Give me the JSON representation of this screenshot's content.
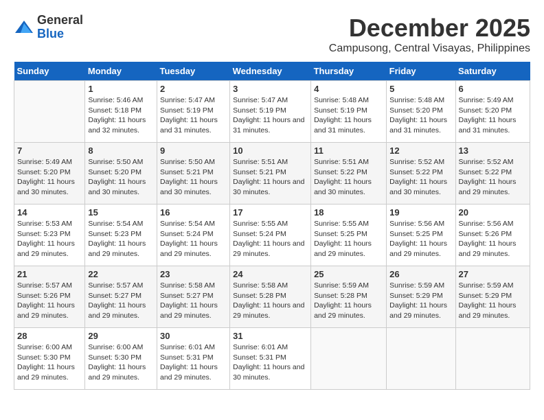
{
  "logo": {
    "text_general": "General",
    "text_blue": "Blue"
  },
  "title": "December 2025",
  "subtitle": "Campusong, Central Visayas, Philippines",
  "weekdays": [
    "Sunday",
    "Monday",
    "Tuesday",
    "Wednesday",
    "Thursday",
    "Friday",
    "Saturday"
  ],
  "weeks": [
    [
      {
        "day": "",
        "sunrise": "",
        "sunset": "",
        "daylight": ""
      },
      {
        "day": "1",
        "sunrise": "Sunrise: 5:46 AM",
        "sunset": "Sunset: 5:18 PM",
        "daylight": "Daylight: 11 hours and 32 minutes."
      },
      {
        "day": "2",
        "sunrise": "Sunrise: 5:47 AM",
        "sunset": "Sunset: 5:19 PM",
        "daylight": "Daylight: 11 hours and 31 minutes."
      },
      {
        "day": "3",
        "sunrise": "Sunrise: 5:47 AM",
        "sunset": "Sunset: 5:19 PM",
        "daylight": "Daylight: 11 hours and 31 minutes."
      },
      {
        "day": "4",
        "sunrise": "Sunrise: 5:48 AM",
        "sunset": "Sunset: 5:19 PM",
        "daylight": "Daylight: 11 hours and 31 minutes."
      },
      {
        "day": "5",
        "sunrise": "Sunrise: 5:48 AM",
        "sunset": "Sunset: 5:20 PM",
        "daylight": "Daylight: 11 hours and 31 minutes."
      },
      {
        "day": "6",
        "sunrise": "Sunrise: 5:49 AM",
        "sunset": "Sunset: 5:20 PM",
        "daylight": "Daylight: 11 hours and 31 minutes."
      }
    ],
    [
      {
        "day": "7",
        "sunrise": "Sunrise: 5:49 AM",
        "sunset": "Sunset: 5:20 PM",
        "daylight": "Daylight: 11 hours and 30 minutes."
      },
      {
        "day": "8",
        "sunrise": "Sunrise: 5:50 AM",
        "sunset": "Sunset: 5:20 PM",
        "daylight": "Daylight: 11 hours and 30 minutes."
      },
      {
        "day": "9",
        "sunrise": "Sunrise: 5:50 AM",
        "sunset": "Sunset: 5:21 PM",
        "daylight": "Daylight: 11 hours and 30 minutes."
      },
      {
        "day": "10",
        "sunrise": "Sunrise: 5:51 AM",
        "sunset": "Sunset: 5:21 PM",
        "daylight": "Daylight: 11 hours and 30 minutes."
      },
      {
        "day": "11",
        "sunrise": "Sunrise: 5:51 AM",
        "sunset": "Sunset: 5:22 PM",
        "daylight": "Daylight: 11 hours and 30 minutes."
      },
      {
        "day": "12",
        "sunrise": "Sunrise: 5:52 AM",
        "sunset": "Sunset: 5:22 PM",
        "daylight": "Daylight: 11 hours and 30 minutes."
      },
      {
        "day": "13",
        "sunrise": "Sunrise: 5:52 AM",
        "sunset": "Sunset: 5:22 PM",
        "daylight": "Daylight: 11 hours and 29 minutes."
      }
    ],
    [
      {
        "day": "14",
        "sunrise": "Sunrise: 5:53 AM",
        "sunset": "Sunset: 5:23 PM",
        "daylight": "Daylight: 11 hours and 29 minutes."
      },
      {
        "day": "15",
        "sunrise": "Sunrise: 5:54 AM",
        "sunset": "Sunset: 5:23 PM",
        "daylight": "Daylight: 11 hours and 29 minutes."
      },
      {
        "day": "16",
        "sunrise": "Sunrise: 5:54 AM",
        "sunset": "Sunset: 5:24 PM",
        "daylight": "Daylight: 11 hours and 29 minutes."
      },
      {
        "day": "17",
        "sunrise": "Sunrise: 5:55 AM",
        "sunset": "Sunset: 5:24 PM",
        "daylight": "Daylight: 11 hours and 29 minutes."
      },
      {
        "day": "18",
        "sunrise": "Sunrise: 5:55 AM",
        "sunset": "Sunset: 5:25 PM",
        "daylight": "Daylight: 11 hours and 29 minutes."
      },
      {
        "day": "19",
        "sunrise": "Sunrise: 5:56 AM",
        "sunset": "Sunset: 5:25 PM",
        "daylight": "Daylight: 11 hours and 29 minutes."
      },
      {
        "day": "20",
        "sunrise": "Sunrise: 5:56 AM",
        "sunset": "Sunset: 5:26 PM",
        "daylight": "Daylight: 11 hours and 29 minutes."
      }
    ],
    [
      {
        "day": "21",
        "sunrise": "Sunrise: 5:57 AM",
        "sunset": "Sunset: 5:26 PM",
        "daylight": "Daylight: 11 hours and 29 minutes."
      },
      {
        "day": "22",
        "sunrise": "Sunrise: 5:57 AM",
        "sunset": "Sunset: 5:27 PM",
        "daylight": "Daylight: 11 hours and 29 minutes."
      },
      {
        "day": "23",
        "sunrise": "Sunrise: 5:58 AM",
        "sunset": "Sunset: 5:27 PM",
        "daylight": "Daylight: 11 hours and 29 minutes."
      },
      {
        "day": "24",
        "sunrise": "Sunrise: 5:58 AM",
        "sunset": "Sunset: 5:28 PM",
        "daylight": "Daylight: 11 hours and 29 minutes."
      },
      {
        "day": "25",
        "sunrise": "Sunrise: 5:59 AM",
        "sunset": "Sunset: 5:28 PM",
        "daylight": "Daylight: 11 hours and 29 minutes."
      },
      {
        "day": "26",
        "sunrise": "Sunrise: 5:59 AM",
        "sunset": "Sunset: 5:29 PM",
        "daylight": "Daylight: 11 hours and 29 minutes."
      },
      {
        "day": "27",
        "sunrise": "Sunrise: 5:59 AM",
        "sunset": "Sunset: 5:29 PM",
        "daylight": "Daylight: 11 hours and 29 minutes."
      }
    ],
    [
      {
        "day": "28",
        "sunrise": "Sunrise: 6:00 AM",
        "sunset": "Sunset: 5:30 PM",
        "daylight": "Daylight: 11 hours and 29 minutes."
      },
      {
        "day": "29",
        "sunrise": "Sunrise: 6:00 AM",
        "sunset": "Sunset: 5:30 PM",
        "daylight": "Daylight: 11 hours and 29 minutes."
      },
      {
        "day": "30",
        "sunrise": "Sunrise: 6:01 AM",
        "sunset": "Sunset: 5:31 PM",
        "daylight": "Daylight: 11 hours and 29 minutes."
      },
      {
        "day": "31",
        "sunrise": "Sunrise: 6:01 AM",
        "sunset": "Sunset: 5:31 PM",
        "daylight": "Daylight: 11 hours and 30 minutes."
      },
      {
        "day": "",
        "sunrise": "",
        "sunset": "",
        "daylight": ""
      },
      {
        "day": "",
        "sunrise": "",
        "sunset": "",
        "daylight": ""
      },
      {
        "day": "",
        "sunrise": "",
        "sunset": "",
        "daylight": ""
      }
    ]
  ]
}
